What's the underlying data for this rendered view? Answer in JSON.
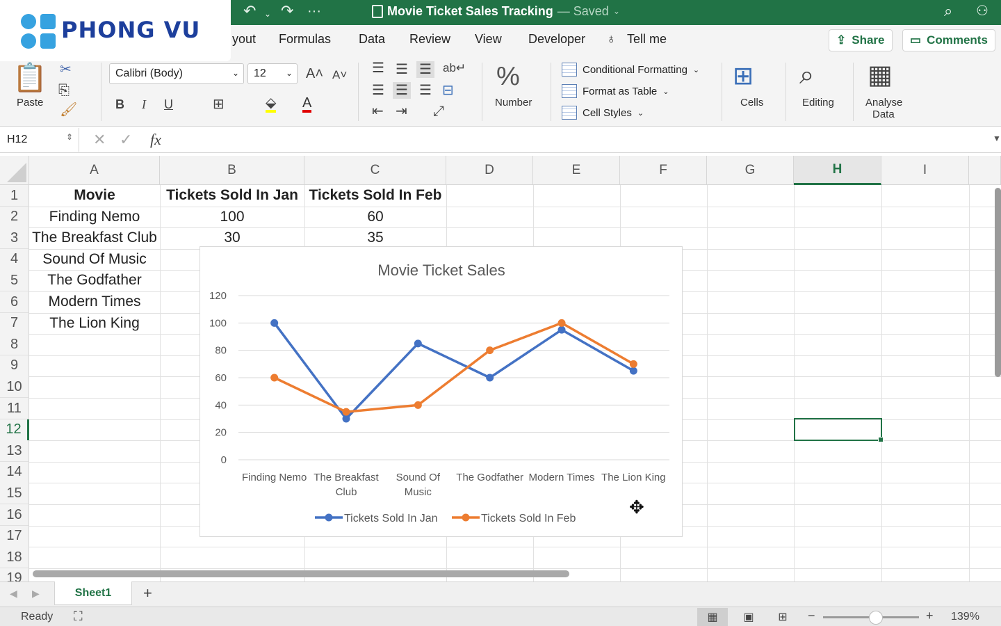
{
  "app": {
    "title": "Movie Ticket Sales Tracking",
    "saved_status": "— Saved",
    "logo_text": "PHONG VU"
  },
  "tabs": [
    "yout",
    "Formulas",
    "Data",
    "Review",
    "View",
    "Developer"
  ],
  "tell_me": "Tell me",
  "share_label": "Share",
  "comments_label": "Comments",
  "ribbon": {
    "paste": "Paste",
    "font_name": "Calibri (Body)",
    "font_size": "12",
    "bold": "B",
    "italic": "I",
    "underline": "U",
    "number": "Number",
    "conditional_formatting": "Conditional Formatting",
    "format_as_table": "Format as Table",
    "cell_styles": "Cell Styles",
    "cells": "Cells",
    "editing": "Editing",
    "analyse_line1": "Analyse",
    "analyse_line2": "Data"
  },
  "formula_bar": {
    "name_box": "H12",
    "fx": "fx",
    "value": ""
  },
  "columns": [
    "A",
    "B",
    "C",
    "D",
    "E",
    "F",
    "G",
    "H",
    "I"
  ],
  "rows": [
    "1",
    "2",
    "3",
    "4",
    "5",
    "6",
    "7",
    "8",
    "9",
    "10",
    "11",
    "12",
    "13",
    "14",
    "15",
    "16",
    "17",
    "18",
    "19"
  ],
  "sheet": {
    "headers": [
      "Movie",
      "Tickets Sold In Jan",
      "Tickets Sold In Feb"
    ],
    "data": [
      [
        "Finding Nemo",
        "100",
        "60"
      ],
      [
        "The Breakfast Club",
        "30",
        "35"
      ],
      [
        "Sound Of Music",
        "",
        ""
      ],
      [
        "The Godfather",
        "",
        ""
      ],
      [
        "Modern Times",
        "",
        ""
      ],
      [
        "The Lion King",
        "",
        ""
      ]
    ]
  },
  "colors": {
    "accent": "#217346",
    "series_jan": "#4472C4",
    "series_feb": "#ED7D31"
  },
  "chart_data": {
    "type": "line",
    "title": "Movie Ticket Sales",
    "categories": [
      "Finding Nemo",
      "The Breakfast Club",
      "Sound Of Music",
      "The Godfather",
      "Modern Times",
      "The Lion King"
    ],
    "category_lines": [
      [
        "Finding Nemo"
      ],
      [
        "The Breakfast",
        "Club"
      ],
      [
        "Sound Of",
        "Music"
      ],
      [
        "The Godfather"
      ],
      [
        "Modern Times"
      ],
      [
        "The Lion King"
      ]
    ],
    "series": [
      {
        "name": "Tickets Sold In Jan",
        "values": [
          100,
          30,
          85,
          60,
          95,
          65
        ],
        "color": "#4472C4"
      },
      {
        "name": "Tickets Sold In Feb",
        "values": [
          60,
          35,
          40,
          80,
          100,
          70
        ],
        "color": "#ED7D31"
      }
    ],
    "yticks": [
      0,
      20,
      40,
      60,
      80,
      100,
      120
    ],
    "ylim": [
      0,
      120
    ],
    "xlabel": "",
    "ylabel": "",
    "grid": true,
    "legend": "bottom"
  },
  "sheet_tabs": [
    "Sheet1"
  ],
  "add_sheet": "+",
  "status": {
    "ready": "Ready",
    "zoom": "139%"
  }
}
